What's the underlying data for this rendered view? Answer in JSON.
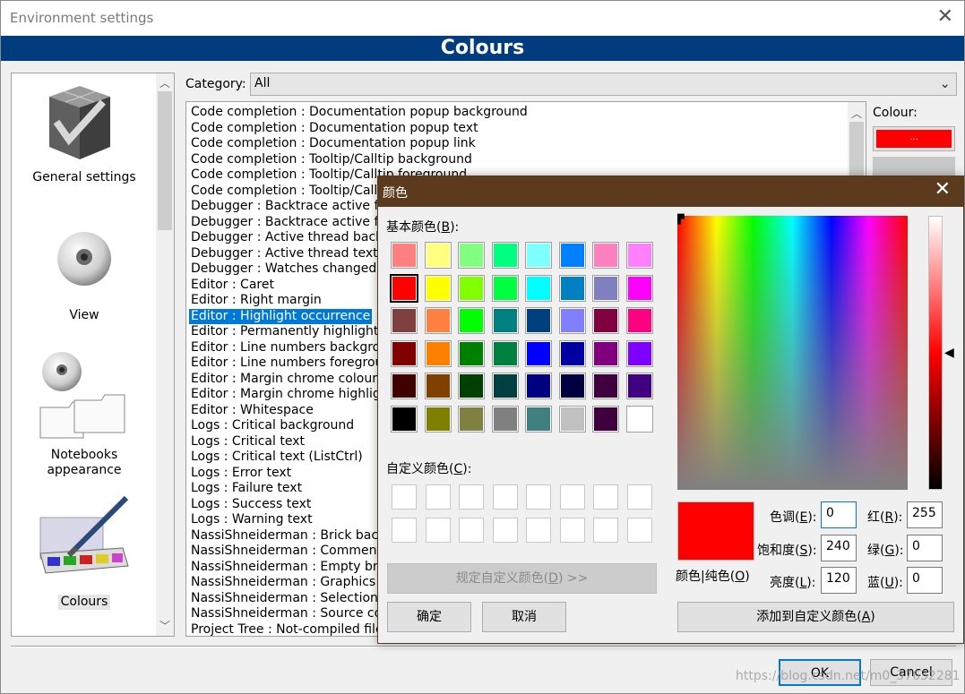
{
  "window": {
    "title": "Environment settings",
    "banner": "Colours"
  },
  "sidebar": {
    "items": [
      {
        "label": "General settings",
        "icon": "general-settings-icon"
      },
      {
        "label": "View",
        "icon": "eye-icon"
      },
      {
        "label": "Notebooks appearance",
        "icon": "notebooks-icon"
      },
      {
        "label": "Colours",
        "icon": "palette-icon",
        "selected": true
      }
    ]
  },
  "category": {
    "label": "Category:",
    "value": "All"
  },
  "list": {
    "items": [
      "Code completion : Documentation popup background",
      "Code completion : Documentation popup text",
      "Code completion : Documentation popup link",
      "Code completion : Tooltip/Calltip background",
      "Code completion : Tooltip/Calltip foreground",
      "Code completion : Tooltip/Call",
      "Debugger : Backtrace active fr",
      "Debugger : Backtrace active fr",
      "Debugger : Active thread back",
      "Debugger : Active thread text",
      "Debugger : Watches changed",
      "Editor : Caret",
      "Editor : Right margin",
      "Editor : Highlight occurrence",
      "Editor : Permanently highlighte",
      "Editor : Line numbers backgrou",
      "Editor : Line numbers foregrou",
      "Editor : Margin chrome colour",
      "Editor : Margin chrome highligh",
      "Editor : Whitespace",
      "Logs : Critical background",
      "Logs : Critical text",
      "Logs : Critical text (ListCtrl)",
      "Logs : Error text",
      "Logs : Failure text",
      "Logs : Success text",
      "Logs : Warning text",
      "NassiShneiderman : Brick backg",
      "NassiShneiderman : Comment c",
      "NassiShneiderman : Empty bric",
      "NassiShneiderman : Graphics co",
      "NassiShneiderman : Selection c",
      "NassiShneiderman : Source col",
      "Project Tree : Not-compiled file"
    ],
    "selected_index": 13
  },
  "colour_panel": {
    "label": "Colour:",
    "button_text": "...",
    "current": "#ff0000"
  },
  "buttons": {
    "ok": "OK",
    "cancel": "Cancel"
  },
  "watermark": "https://blog.csdn.net/m0_37632281",
  "dialog": {
    "title": "颜色",
    "basic_colors_label": "基本颜色(",
    "basic_colors_key": "B",
    "basic_colors_end": "):",
    "basic_colors": [
      "#ff8080",
      "#ffff80",
      "#80ff80",
      "#00ff80",
      "#80ffff",
      "#0080ff",
      "#ff80c0",
      "#ff80ff",
      "#ff0000",
      "#ffff00",
      "#80ff00",
      "#00ff40",
      "#00ffff",
      "#0080c0",
      "#8080c0",
      "#ff00ff",
      "#804040",
      "#ff8040",
      "#00ff00",
      "#008080",
      "#004080",
      "#8080ff",
      "#800040",
      "#ff0080",
      "#800000",
      "#ff8000",
      "#008000",
      "#008040",
      "#0000ff",
      "#0000a0",
      "#800080",
      "#8000ff",
      "#400000",
      "#804000",
      "#004000",
      "#004040",
      "#000080",
      "#000040",
      "#400040",
      "#400080",
      "#000000",
      "#808000",
      "#808040",
      "#808080",
      "#408080",
      "#c0c0c0",
      "#400040",
      "#ffffff"
    ],
    "selected_basic_index": 8,
    "custom_colors_label": "自定义颜色(",
    "custom_colors_key": "C",
    "custom_colors_end": "):",
    "define_custom_label": "规定自定义颜色(",
    "define_custom_key": "D",
    "define_custom_end": ") >>",
    "ok_label": "确定",
    "cancel_label": "取消",
    "color_solid_label": "颜色|纯色(",
    "color_solid_key": "O",
    "color_solid_end": ")",
    "hue_label": "色调(",
    "hue_key": "E",
    "hue_value": "0",
    "sat_label": "饱和度(",
    "sat_key": "S",
    "sat_value": "240",
    "lum_label": "亮度(",
    "lum_key": "L",
    "lum_value": "120",
    "red_label": "红(",
    "red_key": "R",
    "red_value": "255",
    "green_label": "绿(",
    "green_key": "G",
    "green_value": "0",
    "blue_label": "蓝(",
    "blue_key": "U",
    "blue_value": "0",
    "add_custom_label": "添加到自定义颜色(",
    "add_custom_key": "A",
    "add_custom_end": ")",
    "current_color": "#ff0000"
  }
}
